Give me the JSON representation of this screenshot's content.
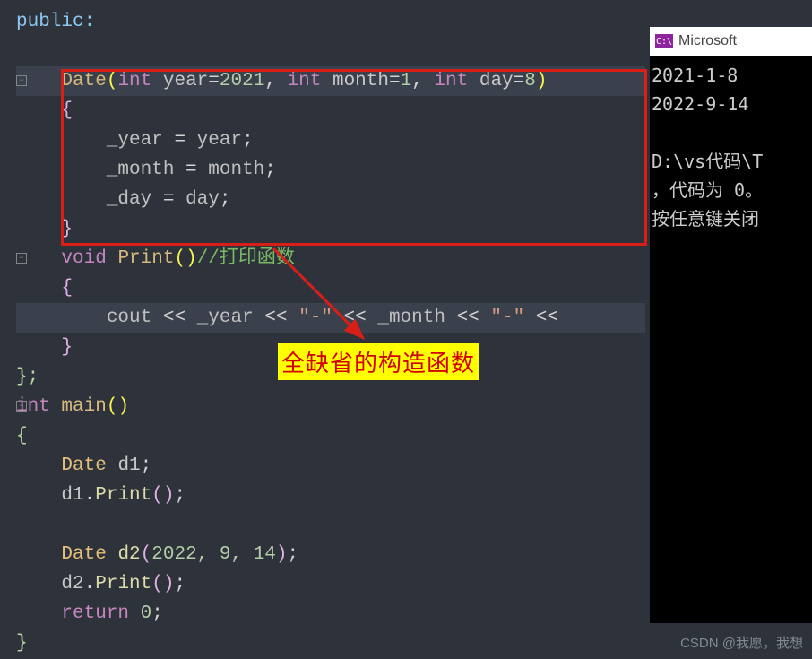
{
  "code": {
    "public_kw": "public",
    "colon": ":",
    "ctor_name": "Date",
    "kw_int": "int",
    "kw_void": "void",
    "kw_return": "return",
    "p_year": "year",
    "p_month": "month",
    "p_day": "day",
    "v_year": "2021",
    "v_month": "1",
    "v_day": "8",
    "m_year": "_year",
    "m_month": "_month",
    "m_day": "_day",
    "eq": " = ",
    "comma": ", ",
    "semi": ";",
    "lparen": "(",
    "rparen": ")",
    "lbrace": "{",
    "rbrace": "}",
    "rbsemi": "};",
    "print_name": "Print",
    "print_comment": "//打印函数",
    "cout": "cout",
    "lshift": " << ",
    "dash_str": "\"-\"",
    "main_name": "main",
    "d1": "d1",
    "d2": "d2",
    "Date_cls": "Date",
    "dot": ".",
    "args2": "2022, 9, 14",
    "zero": "0"
  },
  "annotation": "全缺省的构造函数",
  "console": {
    "app_title": "Microsoft",
    "icon_text": "C:\\",
    "out1": "2021-1-8",
    "out2": "2022-9-14",
    "path": "D:\\vs代码\\T",
    "exitmsg": "，代码为 0。",
    "anykey": "按任意键关闭"
  },
  "watermark": "CSDN @我愿，我想"
}
